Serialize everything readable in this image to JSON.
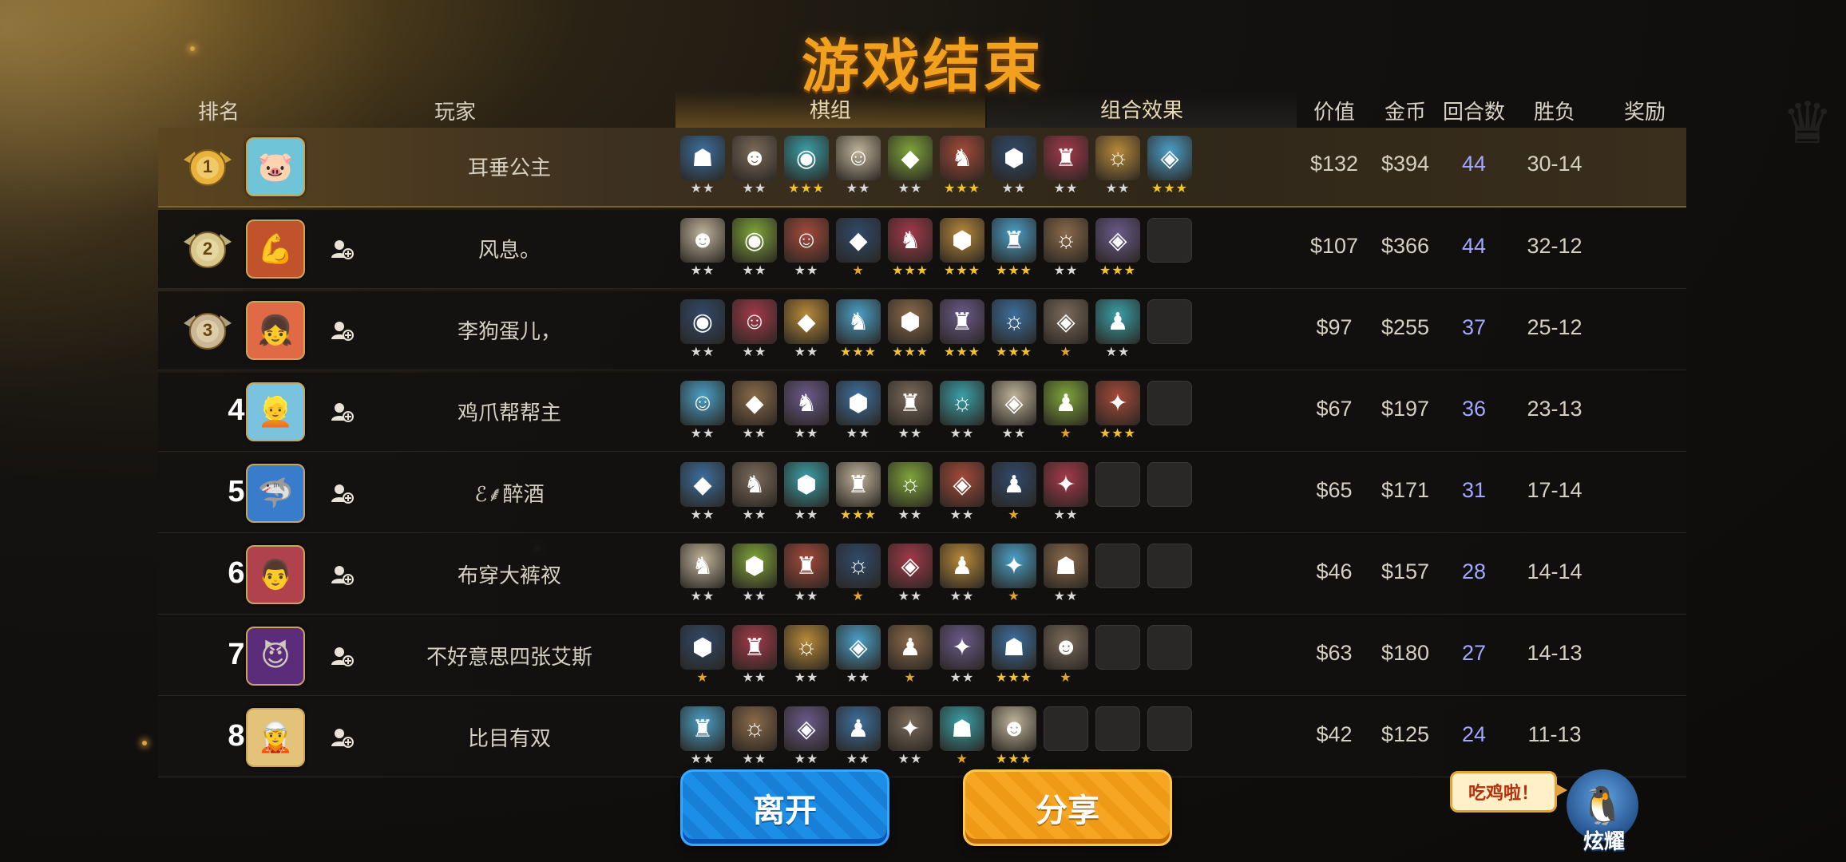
{
  "title": "游戏结束",
  "header": {
    "rank": "排名",
    "player": "玩家",
    "tab_pieces": "棋组",
    "tab_synergy": "组合效果",
    "value": "价值",
    "gold": "金币",
    "rounds": "回合数",
    "winloss": "胜负",
    "reward": "奖励"
  },
  "rows": [
    {
      "rank": "1",
      "name": "耳垂公主",
      "value": "$132",
      "gold": "$394",
      "rounds": "44",
      "winloss": "30-14",
      "avatar": "pig-avatar",
      "pieces": [
        2,
        2,
        3,
        2,
        2,
        3,
        2,
        2,
        2,
        3
      ]
    },
    {
      "rank": "2",
      "name": "风息。",
      "value": "$107",
      "gold": "$366",
      "rounds": "44",
      "winloss": "32-12",
      "avatar": "warrior-avatar",
      "pieces": [
        2,
        2,
        2,
        1,
        3,
        3,
        3,
        2,
        3,
        0
      ]
    },
    {
      "rank": "3",
      "name": "李狗蛋儿，",
      "value": "$97",
      "gold": "$255",
      "rounds": "37",
      "winloss": "25-12",
      "avatar": "girl-avatar",
      "pieces": [
        2,
        2,
        2,
        3,
        3,
        3,
        3,
        1,
        2,
        0
      ]
    },
    {
      "rank": "4",
      "name": "鸡爪帮帮主",
      "value": "$67",
      "gold": "$197",
      "rounds": "36",
      "winloss": "23-13",
      "avatar": "blonde-avatar",
      "pieces": [
        2,
        2,
        2,
        2,
        2,
        2,
        2,
        1,
        3,
        0
      ]
    },
    {
      "rank": "5",
      "name": "ℰ︎⸙醉酒",
      "value": "$65",
      "gold": "$171",
      "rounds": "31",
      "winloss": "17-14",
      "avatar": "shark-avatar",
      "pieces": [
        2,
        2,
        2,
        3,
        2,
        2,
        1,
        2,
        0,
        0
      ]
    },
    {
      "rank": "6",
      "name": "布穿大裤衩",
      "value": "$46",
      "gold": "$157",
      "rounds": "28",
      "winloss": "14-14",
      "avatar": "chef-avatar",
      "pieces": [
        2,
        2,
        2,
        1,
        2,
        2,
        1,
        2,
        0,
        0
      ]
    },
    {
      "rank": "7",
      "name": "不好意思四张艾斯",
      "value": "$63",
      "gold": "$180",
      "rounds": "27",
      "winloss": "14-13",
      "avatar": "demon-avatar",
      "pieces": [
        1,
        2,
        2,
        2,
        1,
        2,
        3,
        1,
        0,
        0
      ]
    },
    {
      "rank": "8",
      "name": "比目有双",
      "value": "$42",
      "gold": "$125",
      "rounds": "24",
      "winloss": "11-13",
      "avatar": "elf-avatar",
      "pieces": [
        2,
        2,
        2,
        2,
        2,
        1,
        3,
        0,
        0,
        0
      ]
    }
  ],
  "buttons": {
    "leave": "离开",
    "share": "分享"
  },
  "bubble": "吃鸡啦！",
  "mascot_label": "炫耀",
  "colors": {
    "title": "#f2a11e",
    "rounds": "#a3a7ff",
    "leave": "#1d8ee8",
    "share": "#f6a623"
  }
}
